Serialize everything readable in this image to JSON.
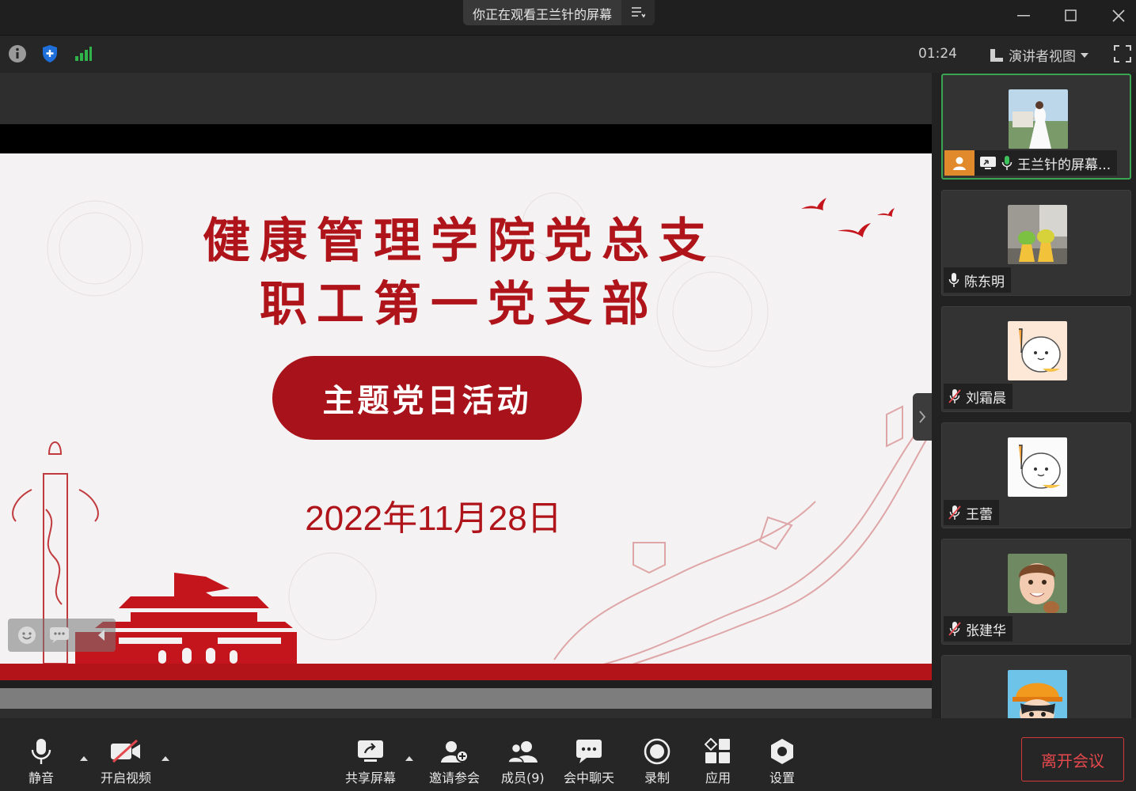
{
  "window": {
    "title": "你正在观看王兰针的屏幕"
  },
  "topbar": {
    "timer": "01:24",
    "view_mode": "演讲者视图"
  },
  "slide": {
    "title_line1": "健康管理学院党总支",
    "title_line2": "职工第一党支部",
    "banner": "主题党日活动",
    "date": "2022年11月28日"
  },
  "participants": [
    {
      "name": "王兰针的屏幕...",
      "mic": "on",
      "sharing": true,
      "active": true
    },
    {
      "name": "陈东明",
      "mic": "on"
    },
    {
      "name": "刘霜晨",
      "mic": "muted"
    },
    {
      "name": "王蕾",
      "mic": "muted"
    },
    {
      "name": "张建华",
      "mic": "muted"
    }
  ],
  "toolbar": {
    "mute": "静音",
    "video": "开启视频",
    "share": "共享屏幕",
    "invite": "邀请参会",
    "members": "成员(9)",
    "chat": "会中聊天",
    "record": "录制",
    "apps": "应用",
    "settings": "设置",
    "leave": "离开会议"
  },
  "colors": {
    "accent_red": "#b0141b",
    "active_border": "#3aa452",
    "leave_red": "#e5484d"
  }
}
